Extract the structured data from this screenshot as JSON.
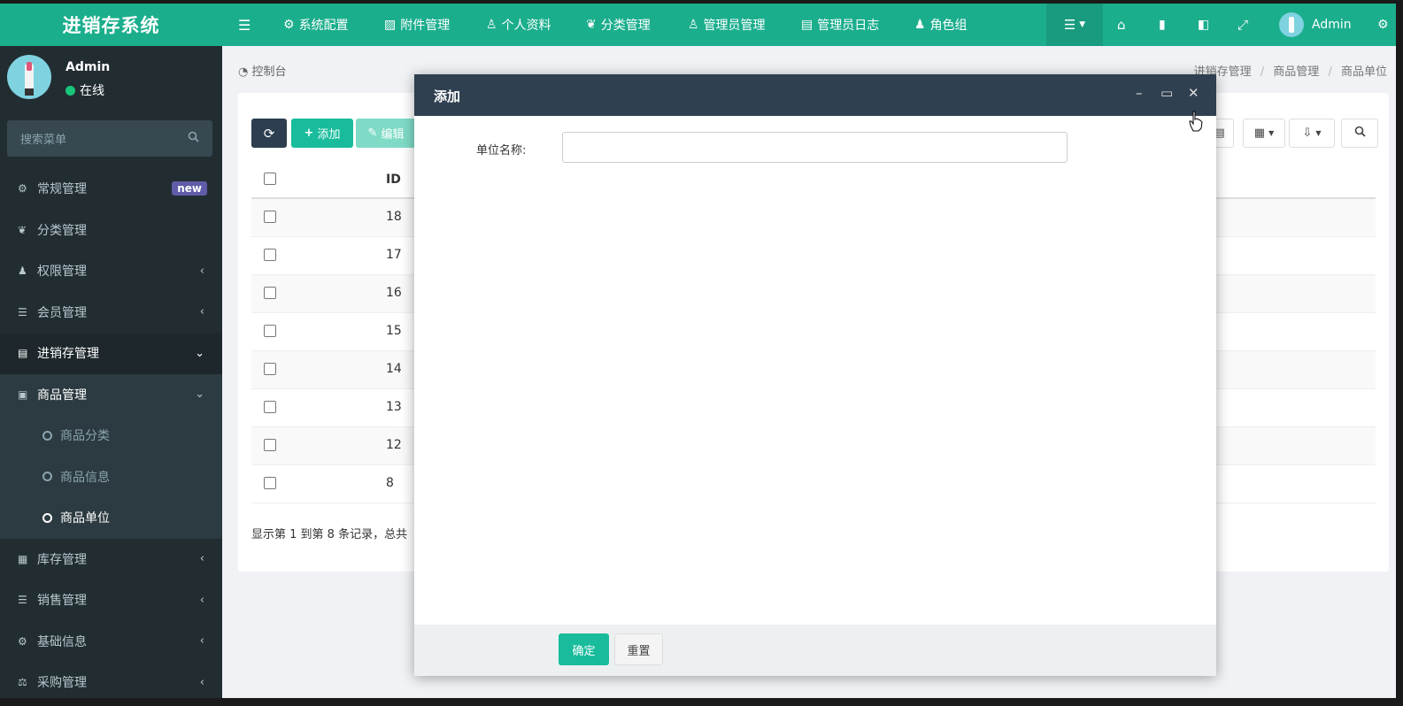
{
  "app": {
    "title": "进销存系统"
  },
  "user": {
    "name": "Admin",
    "status": "在线"
  },
  "search": {
    "placeholder": "搜索菜单"
  },
  "sidebar": {
    "items": [
      {
        "label": "常规管理",
        "icon": "cogs-icon",
        "badge": "new"
      },
      {
        "label": "分类管理",
        "icon": "leaf-icon"
      },
      {
        "label": "权限管理",
        "icon": "group-icon",
        "caret": "‹"
      },
      {
        "label": "会员管理",
        "icon": "list-icon",
        "caret": "‹"
      },
      {
        "label": "进销存管理",
        "icon": "file-icon",
        "caret": "⌄"
      },
      {
        "label": "商品管理",
        "icon": "bag-icon",
        "caret": "⌄"
      },
      {
        "label": "商品分类"
      },
      {
        "label": "商品信息"
      },
      {
        "label": "商品单位"
      },
      {
        "label": "库存管理",
        "icon": "archive-icon",
        "caret": "‹"
      },
      {
        "label": "销售管理",
        "icon": "list-icon",
        "caret": "‹"
      },
      {
        "label": "基础信息",
        "icon": "cogs-icon",
        "caret": "‹"
      },
      {
        "label": "采购管理",
        "icon": "balance-icon",
        "caret": "‹"
      }
    ]
  },
  "topnav": {
    "items": [
      {
        "label": "系统配置",
        "icon": "gear-icon"
      },
      {
        "label": "附件管理",
        "icon": "image-icon"
      },
      {
        "label": "个人资料",
        "icon": "user-icon"
      },
      {
        "label": "分类管理",
        "icon": "leaf-icon"
      },
      {
        "label": "管理员管理",
        "icon": "user-icon"
      },
      {
        "label": "管理员日志",
        "icon": "list-icon"
      },
      {
        "label": "角色组",
        "icon": "group-icon"
      }
    ],
    "admin": "Admin"
  },
  "breadcrumb": {
    "home": "控制台",
    "path": [
      "进销存管理",
      "商品管理",
      "商品单位"
    ]
  },
  "toolbar": {
    "add": "添加",
    "edit": "编辑"
  },
  "table": {
    "id_header": "ID",
    "ids": [
      "18",
      "17",
      "16",
      "15",
      "14",
      "13",
      "12",
      "8"
    ]
  },
  "footer": {
    "text": "显示第 1 到第 8 条记录，总共"
  },
  "modal": {
    "title": "添加",
    "field_label": "单位名称:",
    "field_value": "",
    "ok": "确定",
    "reset": "重置"
  },
  "colors": {
    "primary": "#1bae8d",
    "sidebar": "#222d32",
    "modal_header": "#2f4050",
    "new_badge": "#605ca8"
  }
}
